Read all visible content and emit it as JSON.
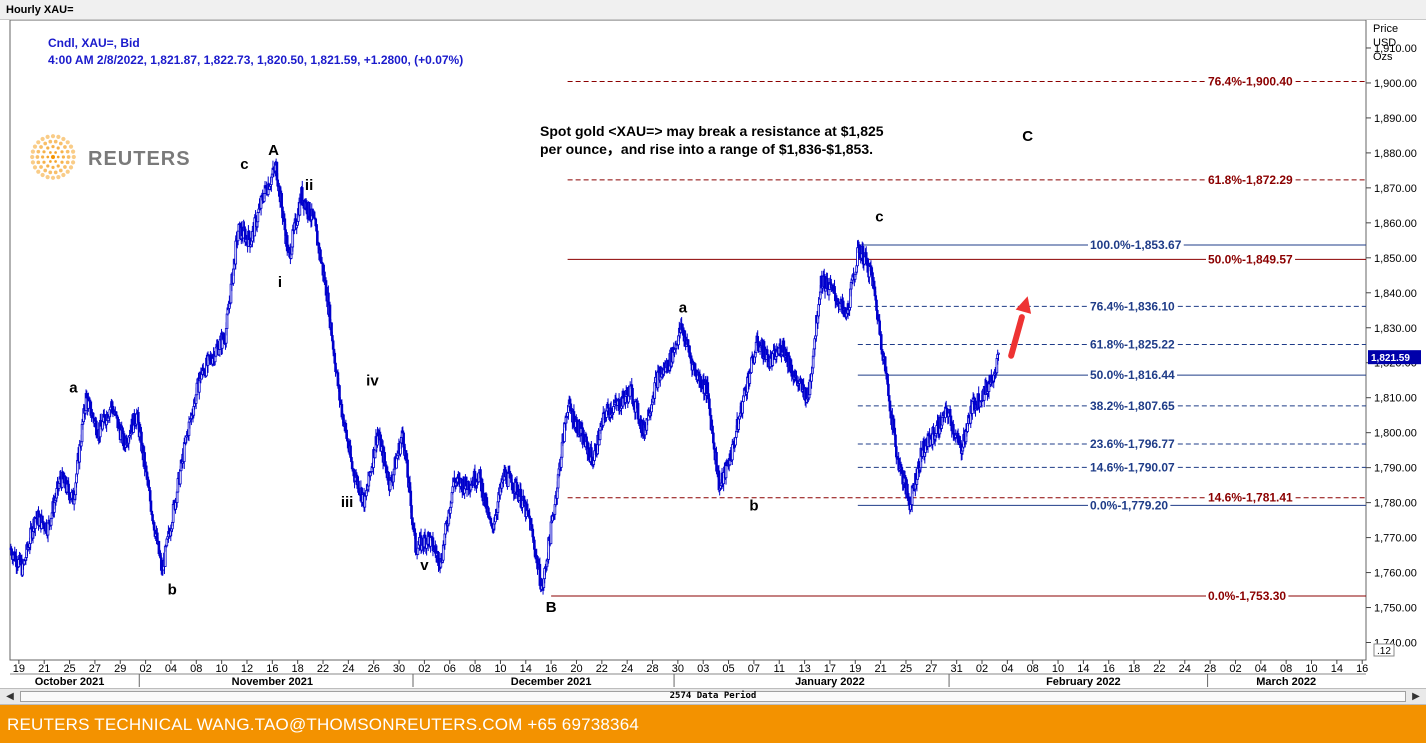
{
  "window": {
    "title": "Hourly XAU="
  },
  "legend": {
    "line1": "Cndl, XAU=, Bid",
    "line2": "4:00 AM 2/8/2022, 1,821.87, 1,822.73, 1,820.50, 1,821.59, +1.2800, (+0.07%)"
  },
  "logo": {
    "text": "REUTERS"
  },
  "annotation": {
    "line1": "Spot gold <XAU=> may break a resistance at $1,825",
    "line2": "per ounce，and rise into a range of $1,836-$1,853."
  },
  "footer": {
    "text": "REUTERS TECHNICAL  WANG.TAO@THOMSONREUTERS.COM  +65 69738364"
  },
  "scrollbar": {
    "label": "2574 Data Period"
  },
  "colors": {
    "candle": "#0000cc",
    "fib_blue": "#1f3c88",
    "fib_red": "#8b0000",
    "arrow": "#ee3333",
    "footer": "#f39200"
  },
  "chart_data": {
    "type": "candlestick",
    "instrument": "XAU=",
    "price_axis": {
      "title": [
        "Price",
        "USD",
        "Ozs"
      ],
      "ylim": [
        1735,
        1918
      ],
      "ticks": [
        1740,
        1750,
        1760,
        1770,
        1780,
        1790,
        1800,
        1810,
        1820,
        1830,
        1840,
        1850,
        1860,
        1870,
        1880,
        1890,
        1900,
        1910
      ],
      "tick_labels": [
        "1,740.00",
        "1,750.00",
        "1,760.00",
        "1,770.00",
        "1,780.00",
        "1,790.00",
        "1,800.00",
        "1,810.00",
        "1,820.00",
        "1,830.00",
        "1,840.00",
        "1,850.00",
        "1,860.00",
        "1,870.00",
        "1,880.00",
        "1,890.00",
        "1,900.00",
        "1,910.00"
      ],
      "last_price_label": "1,821.59",
      "last_price": 1821.59,
      "corner_label": ".12"
    },
    "date_axis": {
      "day_ticks": [
        {
          "label": "19",
          "i": 0.7
        },
        {
          "label": "21",
          "i": 2.7
        },
        {
          "label": "25",
          "i": 4.7
        },
        {
          "label": "27",
          "i": 6.7
        },
        {
          "label": "29",
          "i": 8.7
        },
        {
          "label": "02",
          "i": 10.7
        },
        {
          "label": "04",
          "i": 12.7
        },
        {
          "label": "08",
          "i": 14.7
        },
        {
          "label": "10",
          "i": 16.7
        },
        {
          "label": "12",
          "i": 18.7
        },
        {
          "label": "16",
          "i": 20.7
        },
        {
          "label": "18",
          "i": 22.7
        },
        {
          "label": "22",
          "i": 24.7
        },
        {
          "label": "24",
          "i": 26.7
        },
        {
          "label": "26",
          "i": 28.7
        },
        {
          "label": "30",
          "i": 30.7
        },
        {
          "label": "02",
          "i": 32.7
        },
        {
          "label": "06",
          "i": 34.7
        },
        {
          "label": "08",
          "i": 36.7
        },
        {
          "label": "10",
          "i": 38.7
        },
        {
          "label": "14",
          "i": 40.7
        },
        {
          "label": "16",
          "i": 42.7
        },
        {
          "label": "20",
          "i": 44.7
        },
        {
          "label": "22",
          "i": 46.7
        },
        {
          "label": "24",
          "i": 48.7
        },
        {
          "label": "28",
          "i": 50.7
        },
        {
          "label": "30",
          "i": 52.7
        },
        {
          "label": "03",
          "i": 54.7
        },
        {
          "label": "05",
          "i": 56.7
        },
        {
          "label": "07",
          "i": 58.7
        },
        {
          "label": "11",
          "i": 60.7
        },
        {
          "label": "13",
          "i": 62.7
        },
        {
          "label": "17",
          "i": 64.7
        },
        {
          "label": "19",
          "i": 66.7
        },
        {
          "label": "21",
          "i": 68.7
        },
        {
          "label": "25",
          "i": 70.7
        },
        {
          "label": "27",
          "i": 72.7
        },
        {
          "label": "31",
          "i": 74.7
        },
        {
          "label": "02",
          "i": 76.7
        },
        {
          "label": "04",
          "i": 78.7
        },
        {
          "label": "08",
          "i": 80.7
        },
        {
          "label": "10",
          "i": 82.7
        },
        {
          "label": "14",
          "i": 84.7
        },
        {
          "label": "16",
          "i": 86.7
        },
        {
          "label": "18",
          "i": 88.7
        },
        {
          "label": "22",
          "i": 90.7
        },
        {
          "label": "24",
          "i": 92.7
        },
        {
          "label": "28",
          "i": 94.7
        },
        {
          "label": "02",
          "i": 96.7
        },
        {
          "label": "04",
          "i": 98.7
        },
        {
          "label": "08",
          "i": 100.7
        },
        {
          "label": "10",
          "i": 102.7
        },
        {
          "label": "14",
          "i": 104.7
        },
        {
          "label": "16",
          "i": 106.7
        }
      ],
      "months": [
        {
          "label": "October 2021",
          "i": 4.7
        },
        {
          "label": "November 2021",
          "i": 20.7
        },
        {
          "label": "December 2021",
          "i": 42.7
        },
        {
          "label": "January 2022",
          "i": 64.7
        },
        {
          "label": "February 2022",
          "i": 84.7
        },
        {
          "label": "March 2022",
          "i": 100.7
        }
      ],
      "month_separators": [
        10.2,
        31.8,
        52.4,
        74.1,
        94.5
      ]
    },
    "price_path": [
      [
        0,
        1767
      ],
      [
        1,
        1761
      ],
      [
        2,
        1776
      ],
      [
        3,
        1773
      ],
      [
        4,
        1787
      ],
      [
        5,
        1781
      ],
      [
        6,
        1810
      ],
      [
        7,
        1800
      ],
      [
        8,
        1808
      ],
      [
        9,
        1797
      ],
      [
        10,
        1805
      ],
      [
        11,
        1782
      ],
      [
        12,
        1760
      ],
      [
        13,
        1780
      ],
      [
        14,
        1800
      ],
      [
        15,
        1816
      ],
      [
        16,
        1822
      ],
      [
        17,
        1828
      ],
      [
        18,
        1858
      ],
      [
        19,
        1855
      ],
      [
        20,
        1868
      ],
      [
        21,
        1876
      ],
      [
        22,
        1850
      ],
      [
        23,
        1868
      ],
      [
        24,
        1860
      ],
      [
        25,
        1840
      ],
      [
        26,
        1810
      ],
      [
        27,
        1790
      ],
      [
        28,
        1780
      ],
      [
        29,
        1800
      ],
      [
        30,
        1785
      ],
      [
        31,
        1800
      ],
      [
        32,
        1767
      ],
      [
        33,
        1770
      ],
      [
        34,
        1763
      ],
      [
        35,
        1786
      ],
      [
        36,
        1785
      ],
      [
        37,
        1788
      ],
      [
        38,
        1772
      ],
      [
        39,
        1788
      ],
      [
        40,
        1784
      ],
      [
        41,
        1775
      ],
      [
        42,
        1755
      ],
      [
        43,
        1780
      ],
      [
        44,
        1808
      ],
      [
        45,
        1800
      ],
      [
        46,
        1792
      ],
      [
        47,
        1806
      ],
      [
        48,
        1808
      ],
      [
        49,
        1812
      ],
      [
        50,
        1800
      ],
      [
        51,
        1815
      ],
      [
        52,
        1820
      ],
      [
        53,
        1830
      ],
      [
        54,
        1818
      ],
      [
        55,
        1812
      ],
      [
        56,
        1784
      ],
      [
        57,
        1795
      ],
      [
        58,
        1812
      ],
      [
        59,
        1826
      ],
      [
        60,
        1820
      ],
      [
        61,
        1825
      ],
      [
        62,
        1815
      ],
      [
        63,
        1810
      ],
      [
        64,
        1844
      ],
      [
        65,
        1840
      ],
      [
        66,
        1833
      ],
      [
        67,
        1853
      ],
      [
        68,
        1845
      ],
      [
        69,
        1820
      ],
      [
        70,
        1793
      ],
      [
        71,
        1780
      ],
      [
        72,
        1795
      ],
      [
        73,
        1800
      ],
      [
        74,
        1806
      ],
      [
        75,
        1795
      ],
      [
        76,
        1808
      ],
      [
        77,
        1812
      ],
      [
        78,
        1821
      ]
    ],
    "fib_levels": [
      {
        "label": "76.4%",
        "value": 1900.4,
        "value_label": "1,900.40",
        "color": "red",
        "style": "dashed",
        "x0": 44.0
      },
      {
        "label": "61.8%",
        "value": 1872.29,
        "value_label": "1,872.29",
        "color": "red",
        "style": "dashed",
        "x0": 44.0
      },
      {
        "label": "100.0%",
        "value": 1853.67,
        "value_label": "1,853.67",
        "color": "blue",
        "style": "solid",
        "x0": 66.9
      },
      {
        "label": "50.0%",
        "value": 1849.57,
        "value_label": "1,849.57",
        "color": "red",
        "style": "solid",
        "x0": 44.0
      },
      {
        "label": "76.4%",
        "value": 1836.1,
        "value_label": "1,836.10",
        "color": "blue",
        "style": "dashed",
        "x0": 66.9
      },
      {
        "label": "61.8%",
        "value": 1825.22,
        "value_label": "1,825.22",
        "color": "blue",
        "style": "dashed",
        "x0": 66.9
      },
      {
        "label": "50.0%",
        "value": 1816.44,
        "value_label": "1,816.44",
        "color": "blue",
        "style": "solid",
        "x0": 66.9
      },
      {
        "label": "38.2%",
        "value": 1807.65,
        "value_label": "1,807.65",
        "color": "blue",
        "style": "dashed",
        "x0": 66.9
      },
      {
        "label": "23.6%",
        "value": 1796.77,
        "value_label": "1,796.77",
        "color": "blue",
        "style": "dashed",
        "x0": 66.9
      },
      {
        "label": "14.6%",
        "value": 1790.07,
        "value_label": "1,790.07",
        "color": "blue",
        "style": "dashed",
        "x0": 66.9
      },
      {
        "label": "14.6%",
        "value": 1781.41,
        "value_label": "1,781.41",
        "color": "red",
        "style": "dashed",
        "x0": 44.0
      },
      {
        "label": "0.0%",
        "value": 1779.2,
        "value_label": "1,779.20",
        "color": "blue",
        "style": "solid",
        "x0": 66.9
      },
      {
        "label": "0.0%",
        "value": 1753.3,
        "value_label": "1,753.30",
        "color": "red",
        "style": "solid",
        "x0": 42.7
      }
    ],
    "wave_labels": [
      {
        "text": "a",
        "i": 5.0,
        "price": 1808,
        "pos": "above"
      },
      {
        "text": "b",
        "i": 12.8,
        "price": 1760,
        "pos": "below"
      },
      {
        "text": "c",
        "i": 18.5,
        "price": 1872,
        "pos": "above"
      },
      {
        "text": "A",
        "i": 20.8,
        "price": 1876,
        "pos": "above"
      },
      {
        "text": "ii",
        "i": 23.6,
        "price": 1866,
        "pos": "above"
      },
      {
        "text": "i",
        "i": 21.3,
        "price": 1848,
        "pos": "below"
      },
      {
        "text": "iv",
        "i": 28.6,
        "price": 1810,
        "pos": "above"
      },
      {
        "text": "iii",
        "i": 26.6,
        "price": 1785,
        "pos": "below"
      },
      {
        "text": "v",
        "i": 32.7,
        "price": 1767,
        "pos": "below"
      },
      {
        "text": "B",
        "i": 42.7,
        "price": 1755,
        "pos": "below"
      },
      {
        "text": "a",
        "i": 53.1,
        "price": 1831,
        "pos": "above"
      },
      {
        "text": "b",
        "i": 58.7,
        "price": 1784,
        "pos": "below"
      },
      {
        "text": "c",
        "i": 68.6,
        "price": 1857,
        "pos": "above"
      },
      {
        "text": "C",
        "i": 80.3,
        "price": 1880,
        "pos": "above"
      }
    ],
    "forecast_arrow": {
      "from": [
        79.0,
        1822
      ],
      "to": [
        80.3,
        1839
      ]
    }
  }
}
